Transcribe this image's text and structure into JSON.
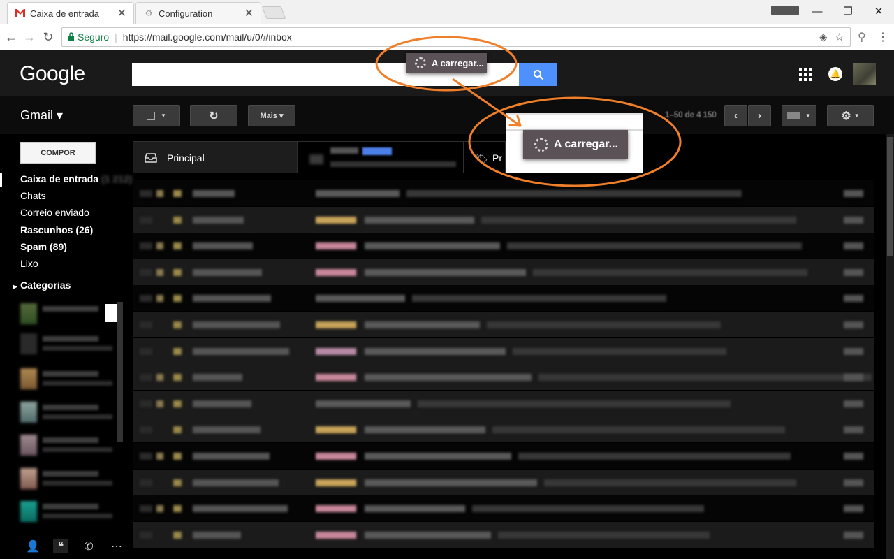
{
  "browser": {
    "tabs": [
      {
        "label": "Caixa de entrada",
        "active": true
      },
      {
        "label": "Configuration",
        "active": false
      }
    ],
    "window_controls": {
      "minimize": "—",
      "restore": "❐",
      "close": "✕"
    },
    "secure_label": "Seguro",
    "url": "https://mail.google.com/mail/u/0/#inbox"
  },
  "header": {
    "logo": "Google",
    "search_placeholder": ""
  },
  "loading": {
    "toast_small": "A carregar...",
    "toast_large": "A carregar..."
  },
  "actionbar": {
    "app_label": "Gmail ▾",
    "more_label": "Mais ▾",
    "pager": "1–50 de 4 150"
  },
  "sidebar": {
    "compose_label": "COMPOR",
    "items": [
      {
        "label": "Caixa de entrada",
        "count": "(1 212)",
        "bold": true
      },
      {
        "label": "Chats",
        "count": "",
        "bold": false
      },
      {
        "label": "Correio enviado",
        "count": "",
        "bold": false
      },
      {
        "label": "Rascunhos (26)",
        "count": "",
        "bold": true
      },
      {
        "label": "Spam (89)",
        "count": "",
        "bold": true
      },
      {
        "label": "Lixo",
        "count": "",
        "bold": false
      },
      {
        "label": "Categorias",
        "count": "",
        "bold": true
      }
    ]
  },
  "inbox_tabs": {
    "primary": "Principal",
    "third": "Pr"
  },
  "colors": {
    "accent_blue": "#4d90fe",
    "toast_bg": "#5a5257",
    "annotation_orange": "#f07f2a"
  }
}
